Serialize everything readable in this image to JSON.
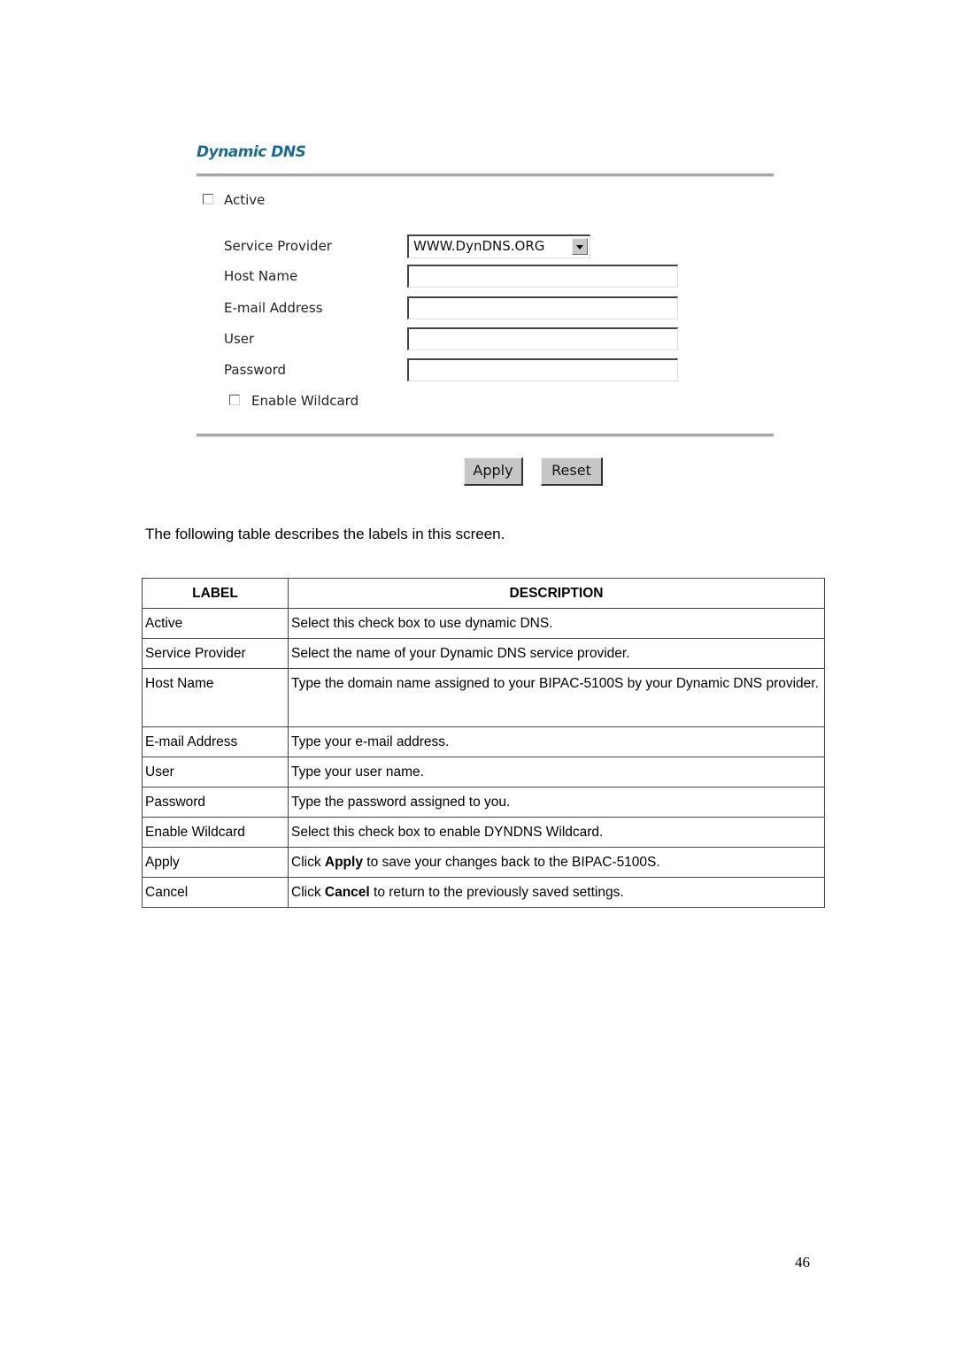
{
  "screenshot": {
    "title": "Dynamic DNS",
    "active_label": "Active",
    "active_checked": false,
    "fields": [
      {
        "label": "Service Provider",
        "type": "select",
        "value": "WWW.DynDNS.ORG"
      },
      {
        "label": "Host Name",
        "type": "text",
        "value": ""
      },
      {
        "label": "E-mail Address",
        "type": "text",
        "value": ""
      },
      {
        "label": "User",
        "type": "text",
        "value": ""
      },
      {
        "label": "Password",
        "type": "password",
        "value": ""
      }
    ],
    "wildcard_label": "Enable Wildcard",
    "wildcard_checked": false,
    "apply_label": "Apply",
    "reset_label": "Reset"
  },
  "intro_text": "The following table describes the labels in this screen.",
  "table": {
    "headers": [
      "LABEL",
      "DESCRIPTION"
    ],
    "rows": [
      {
        "label": "Active",
        "pre": "Select this check box to use dynamic DNS.",
        "bold": "",
        "post": ""
      },
      {
        "label": "Service Provider",
        "pre": "Select the name of your Dynamic DNS service provider.",
        "bold": "",
        "post": ""
      },
      {
        "label": "Host Name",
        "pre": "Type the domain name assigned to your BIPAC-5100S by your Dynamic DNS provider.",
        "bold": "",
        "post": ""
      },
      {
        "label": "E-mail Address",
        "pre": "Type your e-mail address.",
        "bold": "",
        "post": ""
      },
      {
        "label": "User",
        "pre": "Type your user name.",
        "bold": "",
        "post": ""
      },
      {
        "label": "Password",
        "pre": "Type the password assigned to you.",
        "bold": "",
        "post": ""
      },
      {
        "label": "Enable Wildcard",
        "pre": "Select this check box to enable DYNDNS Wildcard.",
        "bold": "",
        "post": ""
      },
      {
        "label": "Apply",
        "pre": "Click ",
        "bold": "Apply",
        "post": " to save your changes back to the BIPAC-5100S."
      },
      {
        "label": "Cancel",
        "pre": "Click ",
        "bold": "Cancel",
        "post": " to return to the previously saved settings."
      }
    ]
  },
  "page_number": "46"
}
